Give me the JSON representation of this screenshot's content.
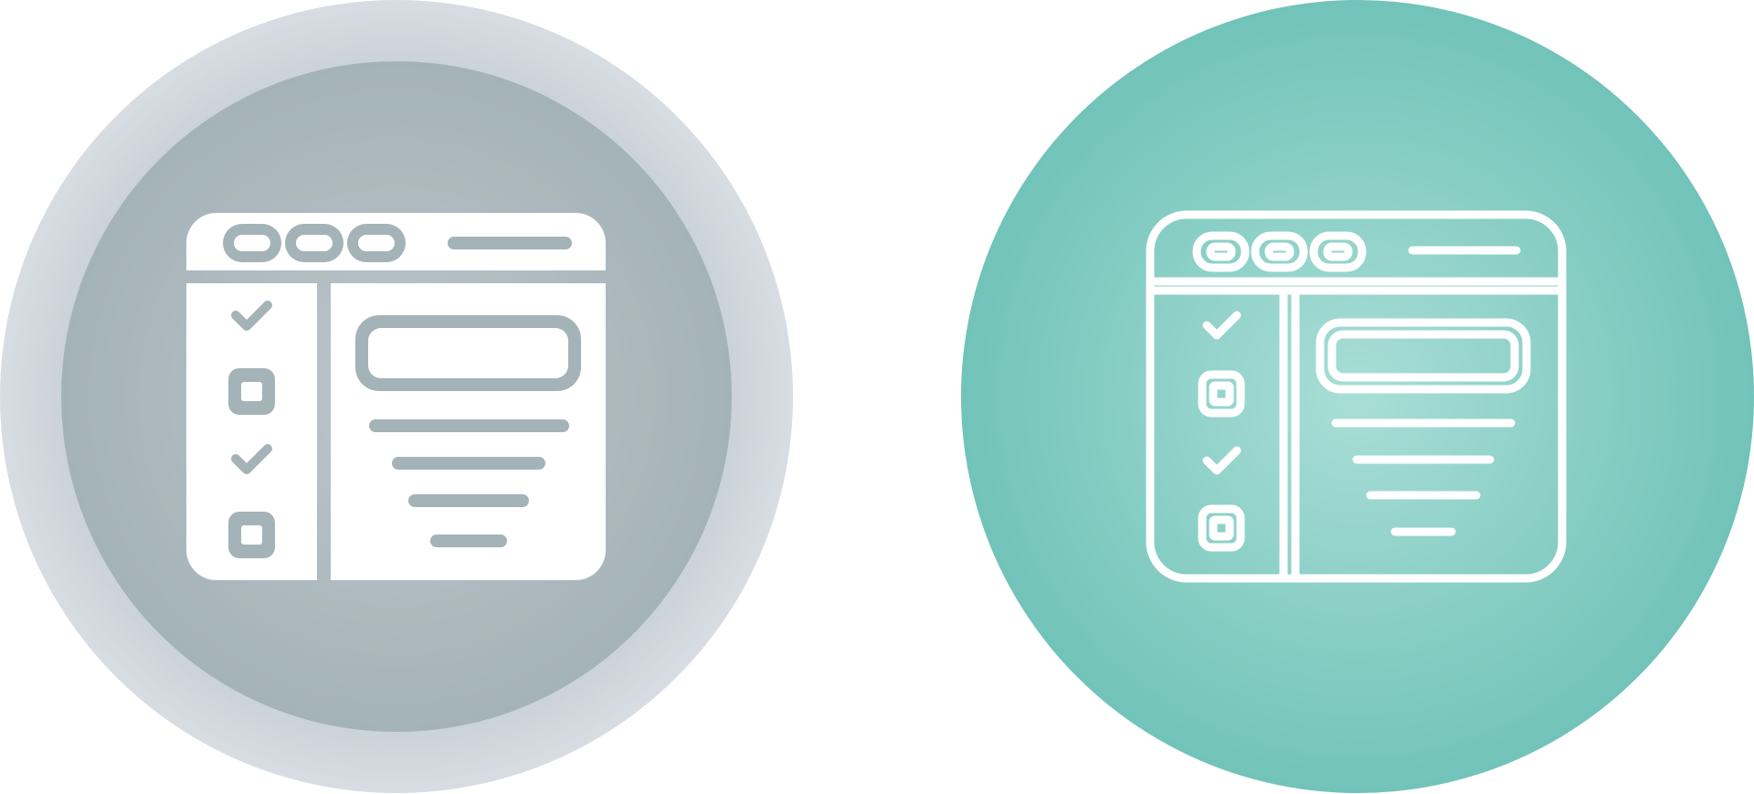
{
  "icons": [
    {
      "name": "checklist-window-glyph-icon",
      "style": "glyph",
      "outer_color": "#D2D8DE",
      "inner_color": "#A4B3B8",
      "icon_color": "#FFFFFF"
    },
    {
      "name": "checklist-window-line-icon",
      "style": "line",
      "outer_color": "#74C4BA",
      "inner_color": "#A9DED6",
      "icon_color": "#FFFFFF"
    }
  ]
}
